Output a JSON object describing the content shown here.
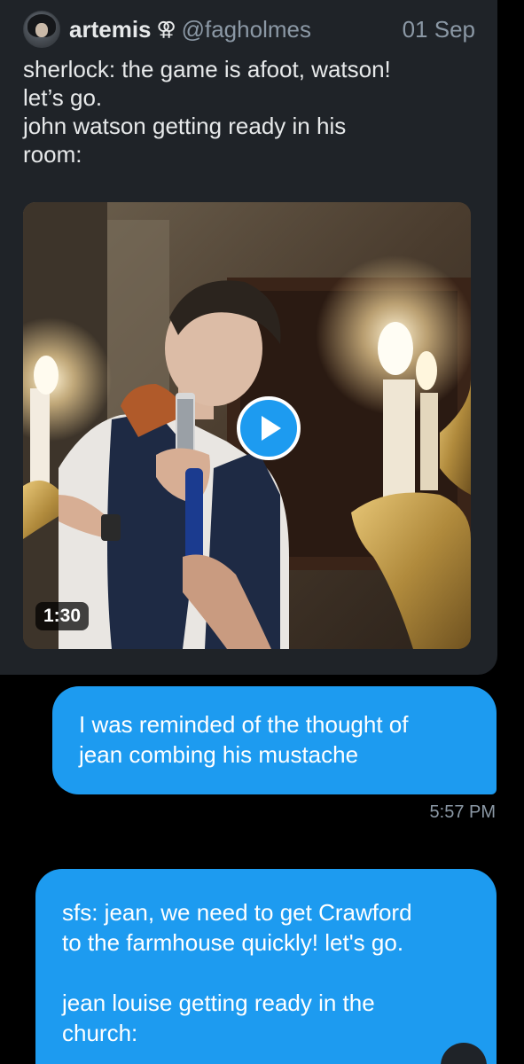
{
  "tweet": {
    "display_name": "artemis",
    "name_symbol": "⚢",
    "handle": "@fagholmes",
    "date": "01 Sep",
    "text_lines": [
      "sherlock: the game is afoot, watson!",
      "let’s go.",
      "john watson getting ready in his",
      "room:"
    ],
    "video": {
      "duration": "1:30",
      "play_icon": "play-icon"
    },
    "avatar_icon": "avatar"
  },
  "messages": [
    {
      "lines": [
        "I was reminded of the thought of",
        "jean  combing his mustache"
      ],
      "timestamp": "5:57 PM"
    },
    {
      "lines": [
        "sfs: jean, we need to get Crawford",
        "to the farmhouse quickly! let's go.",
        "",
        "jean louise getting ready in the",
        "church:"
      ]
    }
  ],
  "colors": {
    "background": "#000000",
    "card": "#1f2328",
    "bubble": "#1d9bf0",
    "muted_text": "#8b98a5",
    "primary_text": "#e7e9ea"
  }
}
